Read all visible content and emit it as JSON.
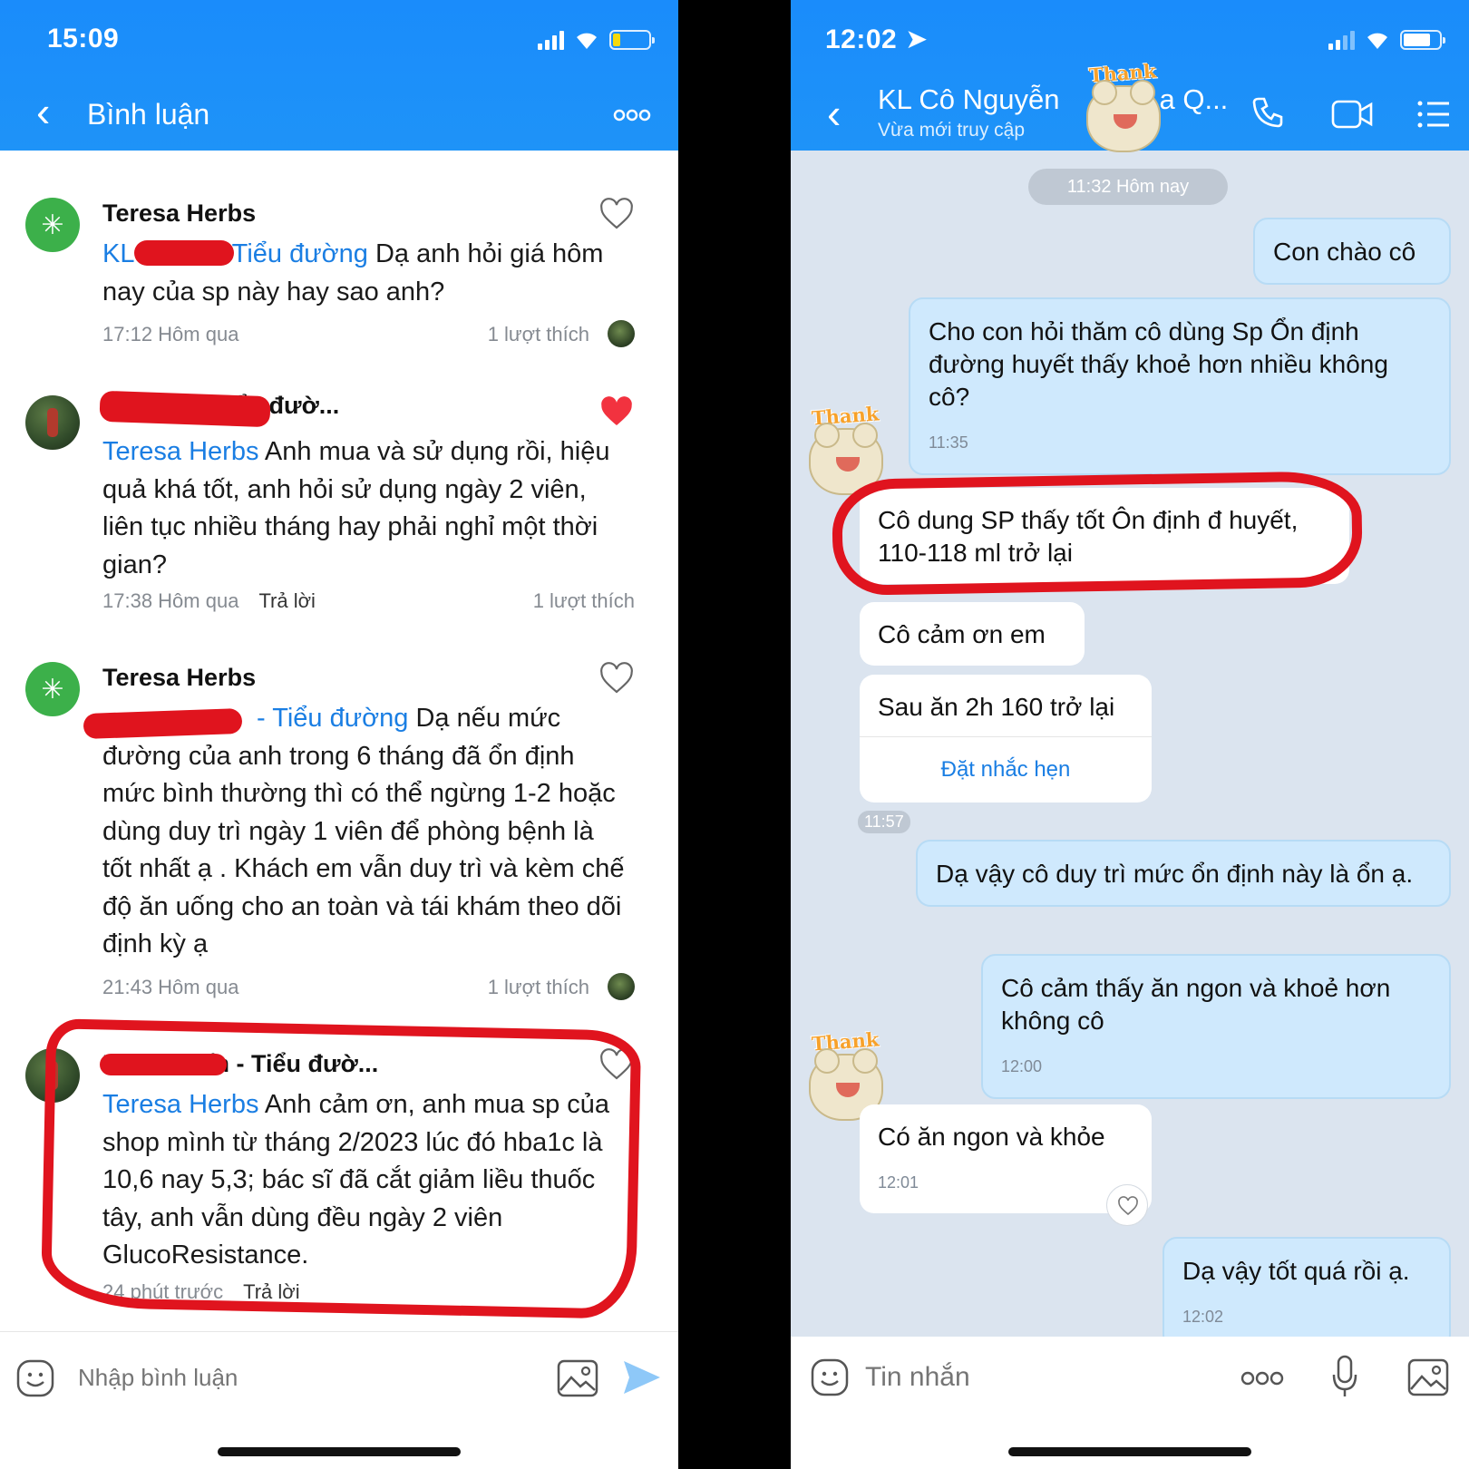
{
  "left": {
    "status": {
      "time": "15:09"
    },
    "header": {
      "title": "Bình luận"
    },
    "comments": [
      {
        "author": "Teresa Herbs",
        "mention_prefix": "KL",
        "mention_suffix": "- Tiểu đường",
        "text": " Dạ anh hỏi giá hôm nay của sp này hay sao anh?",
        "time": "17:12 Hôm qua",
        "likes": "1 lượt thích"
      },
      {
        "author": "Vũ Tiến - Tiểu đườ...",
        "mention": "Teresa Herbs",
        "text": " Anh mua và sử dụng rồi, hiệu quả khá tốt, anh hỏi sử dụng ngày 2 viên, liên tục nhiều tháng hay phải nghỉ một thời gian?",
        "time": "17:38 Hôm qua",
        "reply": "Trả lời",
        "likes": "1 lượt thích"
      },
      {
        "author": "Teresa Herbs",
        "mention_suffix": "- Tiểu đường",
        "text": " Dạ nếu mức đường của anh trong 6 tháng đã ổn định mức bình thường thì có thể ngừng 1-2 hoặc dùng duy trì ngày 1 viên để phòng bệnh là tốt nhất ạ . Khách em vẫn duy trì và kèm chế độ ăn uống cho an toàn và tái khám theo dõi định kỳ ạ",
        "time": "21:43 Hôm qua",
        "likes": "1 lượt thích"
      },
      {
        "author": "KL Vũ Tiến - Tiểu đườ...",
        "mention": "Teresa Herbs",
        "text": " Anh cảm ơn, anh mua sp của shop mình từ tháng 2/2023 lúc đó hba1c là 10,6 nay 5,3; bác sĩ đã cắt giảm liều thuốc tây, anh vẫn dùng đều ngày 2 viên GlucoResistance.",
        "time": "24 phút trước",
        "reply": "Trả lời"
      }
    ],
    "input": {
      "placeholder": "Nhập bình luận"
    }
  },
  "right": {
    "status": {
      "time": "12:02"
    },
    "header": {
      "title": "KL Cô Nguyễn",
      "title_end": "a Q...",
      "subtitle": "Vừa mới truy cập"
    },
    "sticker_label": "Thank You!",
    "date_divider": "11:32 Hôm nay",
    "messages": [
      {
        "dir": "out",
        "text": "Con chào cô"
      },
      {
        "dir": "out",
        "text": "Cho con hỏi thăm cô dùng Sp Ổn định đường huyết thấy khoẻ hơn nhiều không cô?",
        "time": "11:35"
      },
      {
        "dir": "in",
        "text": "Cô dung SP thấy tốt Ôn định đ huyết, 110-118 ml trở lại"
      },
      {
        "dir": "in",
        "text": "Cô cảm ơn em"
      },
      {
        "dir": "in",
        "text": "Sau ăn 2h 160 trở lại",
        "action": "Đặt nhắc hẹn"
      },
      {
        "dir": "stamp",
        "time": "11:57"
      },
      {
        "dir": "out",
        "text": "Dạ vậy cô duy trì mức ổn định này là ổn ạ."
      },
      {
        "dir": "out",
        "text": "Cô cảm thấy ăn ngon và khoẻ hơn không cô",
        "time": "12:00"
      },
      {
        "dir": "in",
        "text": "Có ăn ngon và khỏe",
        "time": "12:01"
      },
      {
        "dir": "out",
        "text": "Dạ vậy tốt quá rồi ạ.",
        "time": "12:02"
      }
    ],
    "input": {
      "placeholder": "Tin nhắn"
    }
  },
  "colors": {
    "header_blue": "#1a8cfb",
    "mention_blue": "#1a7ee3",
    "highlight_red": "#e0141e",
    "bubble_out": "#cfe9fd",
    "chat_bg": "#dbe4ef"
  }
}
